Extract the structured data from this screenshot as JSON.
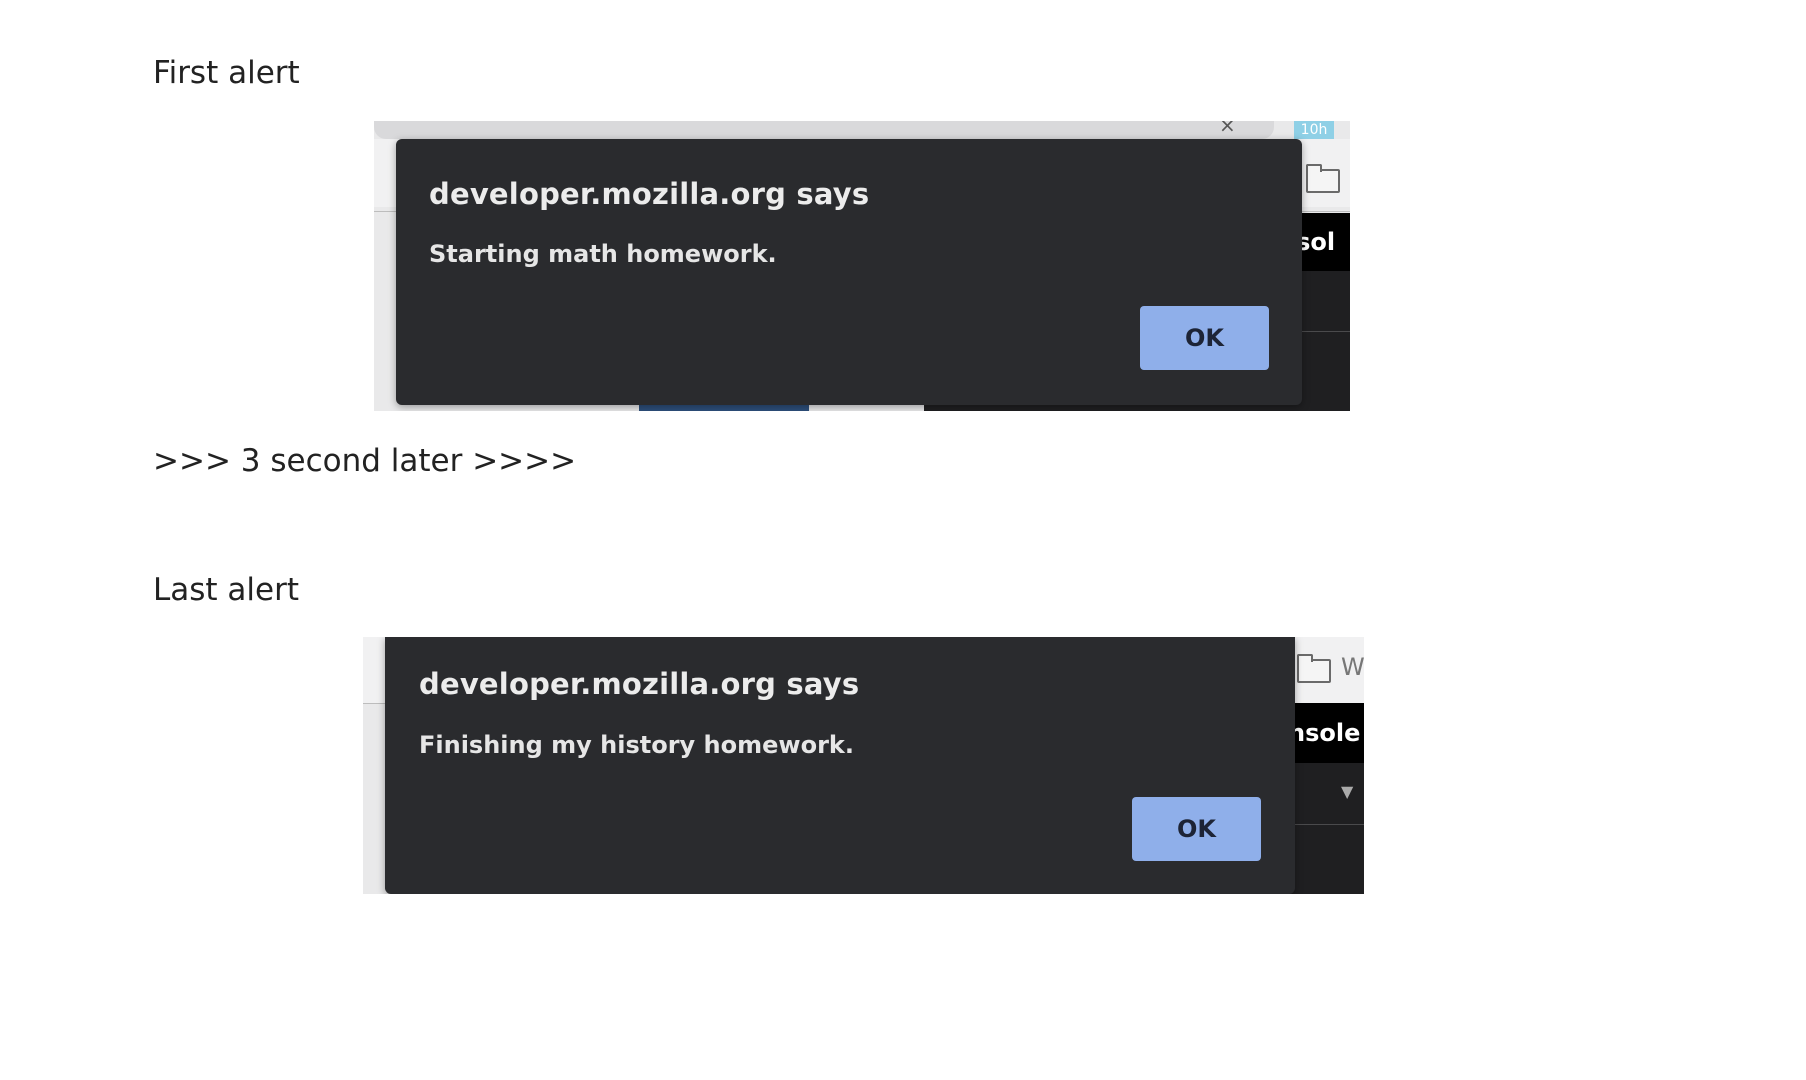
{
  "headings": {
    "first": "First alert",
    "middle": ">>> 3 second later >>>>",
    "last": "Last alert"
  },
  "alert_first": {
    "title": "developer.mozilla.org says",
    "message": "Starting math homework.",
    "ok_label": "OK"
  },
  "alert_last": {
    "title": "developer.mozilla.org says",
    "message": "Finishing my history homework.",
    "ok_label": "OK"
  },
  "background": {
    "badge": "10h",
    "console_tab_partial_1": "nsol",
    "console_tab_partial_2": "nsole",
    "partial_text": "W",
    "close_glyph": "×",
    "caret_glyph": "▼"
  },
  "colors": {
    "dialog_bg": "#2a2b2e",
    "ok_button": "#8fafea",
    "devtools_bg": "#1f1f21"
  }
}
